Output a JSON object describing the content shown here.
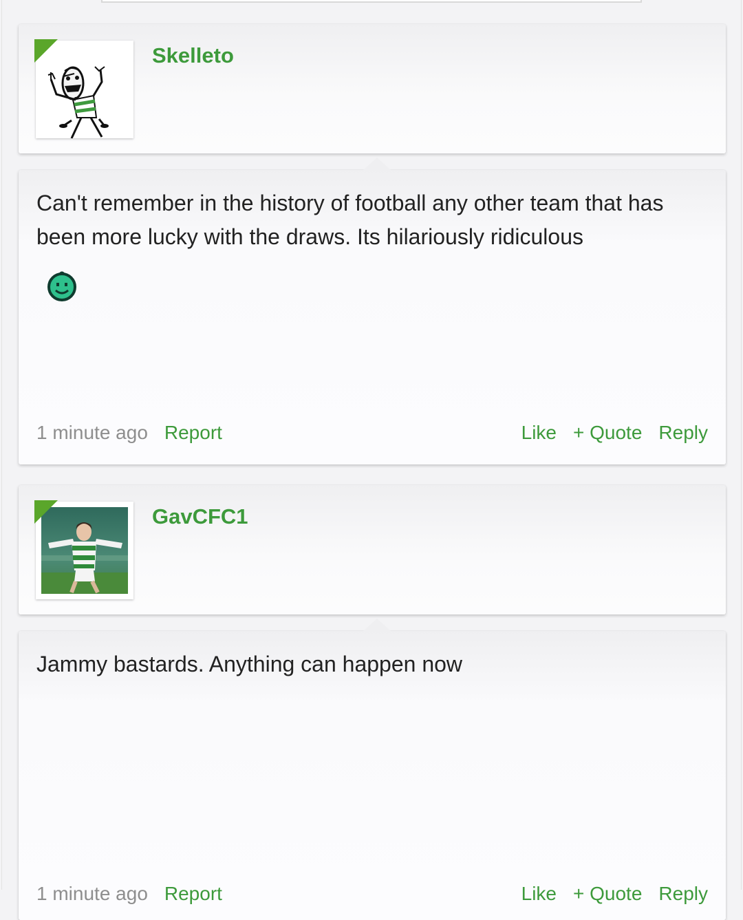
{
  "posts": [
    {
      "username": "Skelleto",
      "avatar": "stick-figure-avatar",
      "text": "Can't remember in the history of football any other team that has been more lucky with the draws. Its hilariously ridiculous",
      "emoji": "green-smiley-icon",
      "time": "1 minute ago",
      "report_label": "Report",
      "like_label": "Like",
      "quote_label": "+ Quote",
      "reply_label": "Reply"
    },
    {
      "username": "GavCFC1",
      "avatar": "footballer-photo-avatar",
      "text": "Jammy bastards. Anything can happen now",
      "time": "1 minute ago",
      "report_label": "Report",
      "like_label": "Like",
      "quote_label": "+ Quote",
      "reply_label": "Reply"
    }
  ],
  "colors": {
    "accent": "#3d9a3b",
    "flag": "#5aa62a",
    "text": "#222222",
    "muted": "#8e8e8e"
  }
}
